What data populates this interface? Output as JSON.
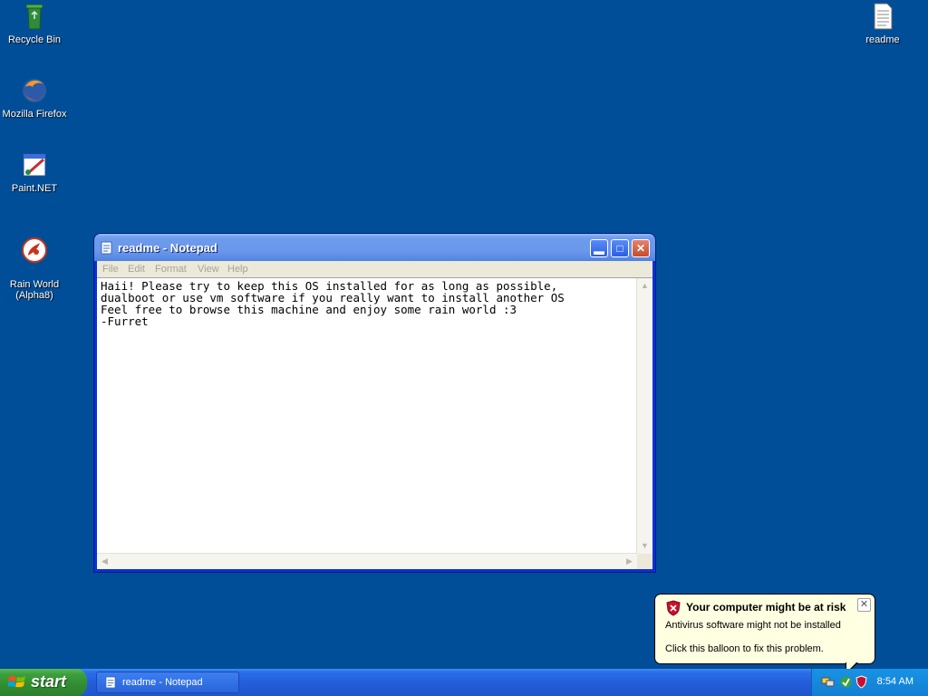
{
  "desktop": {
    "icons": [
      {
        "label": "Recycle Bin"
      },
      {
        "label": "Mozilla Firefox"
      },
      {
        "label": "Paint.NET"
      },
      {
        "label": "Rain World\n(Alpha8)"
      },
      {
        "label": "readme"
      }
    ]
  },
  "notepad": {
    "title": "readme - Notepad",
    "menu": [
      "File",
      "Edit",
      "Format",
      "View",
      "Help"
    ],
    "content": "Haii! Please try to keep this OS installed for as long as possible,\ndualboot or use vm software if you really want to install another OS\nFeel free to browse this machine and enjoy some rain world :3\n-Furret"
  },
  "balloon": {
    "title": "Your computer might be at risk",
    "line1": "Antivirus software might not be installed",
    "line2": "Click this balloon to fix this problem."
  },
  "taskbar": {
    "start_label": "start",
    "items": [
      {
        "label": "readme - Notepad"
      }
    ],
    "clock": "8:54 AM"
  },
  "colors": {
    "desktop": "#004e98",
    "taskbar": "#245edb",
    "start": "#3c9f3c",
    "balloon": "#ffffe1"
  },
  "icons": [
    "recycle-bin-icon",
    "firefox-icon",
    "paint-net-icon",
    "rain-world-icon",
    "readme-file-icon",
    "notepad-icon",
    "security-shield-icon",
    "windows-flag-icon"
  ]
}
